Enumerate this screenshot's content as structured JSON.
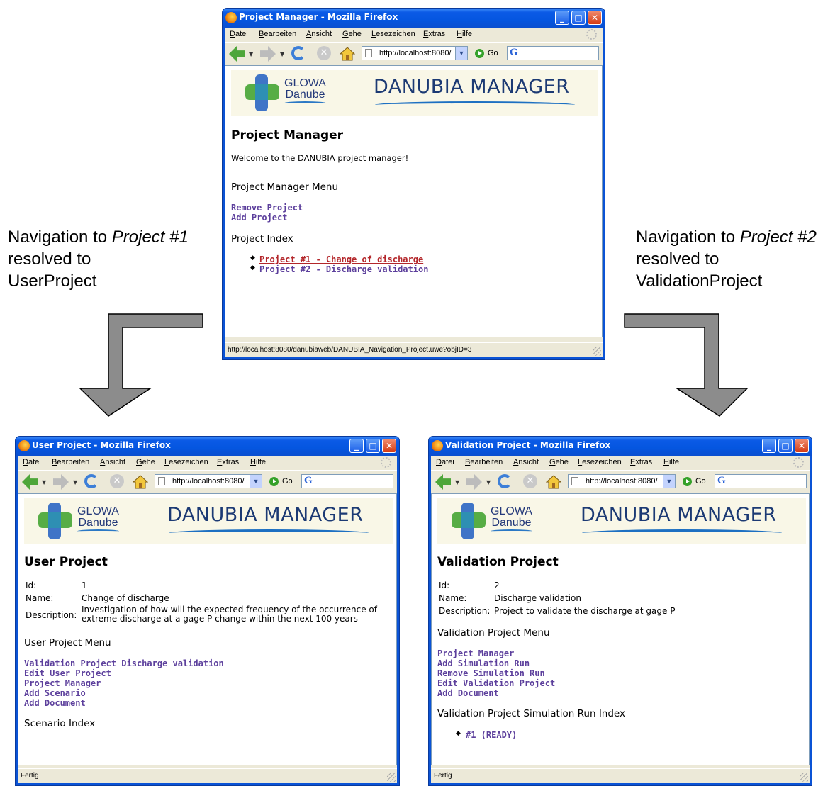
{
  "captions": {
    "left": {
      "prefix": "Navigation to ",
      "italic": "Project #1",
      "line2": "resolved to",
      "line3": "UserProject"
    },
    "right": {
      "prefix": "Navigation to ",
      "italic": "Project #2",
      "line2": "resolved to",
      "line3": "ValidationProject"
    }
  },
  "browser": {
    "menu": [
      "Datei",
      "Bearbeiten",
      "Ansicht",
      "Gehe",
      "Lesezeichen",
      "Extras",
      "Hilfe"
    ],
    "url": "http://localhost:8080/",
    "go_label": "Go",
    "banner": {
      "glowa_1": "GLOWA",
      "glowa_2": "Danube",
      "title": "DANUBIA MANAGER"
    }
  },
  "top_window": {
    "title": "Project Manager - Mozilla Firefox",
    "heading": "Project Manager",
    "welcome": "Welcome to the DANUBIA project manager!",
    "menu_heading": "Project Manager Menu",
    "menu_links": [
      "Remove Project",
      "Add Project"
    ],
    "index_heading": "Project Index",
    "index_items": [
      "Project #1 - Change of discharge",
      "Project #2 - Discharge validation"
    ],
    "status": "http://localhost:8080/danubiaweb/DANUBIA_Navigation_Project.uwe?objID=3"
  },
  "left_window": {
    "title": "User Project - Mozilla Firefox",
    "heading": "User Project",
    "fields": {
      "id_label": "Id:",
      "id_value": "1",
      "name_label": "Name:",
      "name_value": "Change of discharge",
      "desc_label": "Description:",
      "desc_value_1": "Investigation of how will the expected frequency of the occurrence of",
      "desc_value_2": "extreme discharge at a gage P change within the next 100 years"
    },
    "menu_heading": "User Project Menu",
    "menu_links": [
      "Validation Project Discharge validation",
      "Edit User Project",
      "Project Manager",
      "Add Scenario",
      "Add Document"
    ],
    "index_heading": "Scenario Index",
    "status": "Fertig"
  },
  "right_window": {
    "title": "Validation Project - Mozilla Firefox",
    "heading": "Validation Project",
    "fields": {
      "id_label": "Id:",
      "id_value": "2",
      "name_label": "Name:",
      "name_value": "Discharge validation",
      "desc_label": "Description:",
      "desc_value": "Project to validate the discharge at gage P"
    },
    "menu_heading": "Validation Project Menu",
    "menu_links": [
      "Project Manager",
      "Add Simulation Run",
      "Remove Simulation Run",
      "Edit Validation Project",
      "Add Document"
    ],
    "index_heading": "Validation Project Simulation Run Index",
    "index_items": [
      "#1 (READY)"
    ],
    "status": "Fertig"
  }
}
